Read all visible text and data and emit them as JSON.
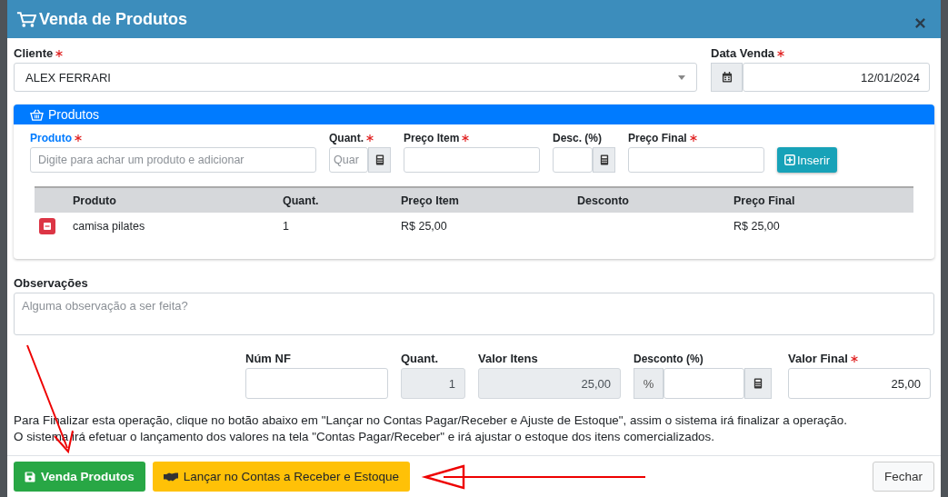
{
  "modal": {
    "title": "Venda de Produtos"
  },
  "cliente": {
    "label": "Cliente",
    "required": true,
    "value": "ALEX FERRARI"
  },
  "data_venda": {
    "label": "Data Venda",
    "required": true,
    "value": "12/01/2024"
  },
  "produtos": {
    "title": "Produtos",
    "fields": [
      {
        "label": "Produto",
        "required": true,
        "active": true,
        "kind": "text",
        "placeholder": "Digite para achar um produto e adicionar"
      },
      {
        "label": "Quant.",
        "required": true,
        "active": false,
        "kind": "calc",
        "placeholder": "Quar"
      },
      {
        "label": "Preço Item",
        "required": true,
        "active": false,
        "kind": "text"
      },
      {
        "label": "Desc. (%)",
        "required": false,
        "active": false,
        "kind": "calc"
      },
      {
        "label": "Preço Final",
        "required": true,
        "active": false,
        "kind": "text"
      }
    ],
    "insert_button": "Inserir",
    "table": {
      "columns": [
        "Produto",
        "Quant.",
        "Preço Item",
        "Desconto",
        "Preço Final"
      ],
      "rows": [
        {
          "cells": [
            "camisa pilates",
            "1",
            "R$ 25,00",
            null,
            "R$ 25,00"
          ]
        }
      ]
    }
  },
  "observacoes": {
    "label": "Observações",
    "placeholder": "Alguma observação a ser feita?"
  },
  "totals": [
    {
      "label": "Núm NF",
      "required": false,
      "disabled": false,
      "kind": "text"
    },
    {
      "label": "Quant.",
      "required": false,
      "disabled": true,
      "kind": "text",
      "value": "1"
    },
    {
      "label": "Valor Itens",
      "required": false,
      "disabled": true,
      "kind": "text",
      "value": "25,00"
    },
    {
      "label": "Desconto (%)",
      "required": false,
      "disabled": false,
      "kind": "percent",
      "prefix": "%"
    },
    {
      "label": "Valor Final",
      "required": true,
      "disabled": false,
      "kind": "text",
      "value": "25,00"
    }
  ],
  "info": [
    "Para Finalizar esta operação, clique no botão abaixo em \"Lançar no Contas Pagar/Receber e Ajuste de Estoque\", assim o sistema irá finalizar a operação.",
    "O sistema irá efetuar o lançamento dos valores na tela \"Contas Pagar/Receber\" e irá ajustar o estoque dos itens comercializados."
  ],
  "buttons": [
    {
      "label": "Venda Produtos",
      "kind": "success"
    },
    {
      "label": "Lançar no Contas a Receber e Estoque",
      "kind": "warning"
    },
    {
      "label": "Fechar",
      "kind": "secondary"
    }
  ]
}
